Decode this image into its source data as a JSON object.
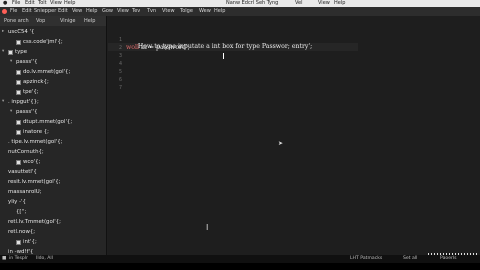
{
  "sysbar": {
    "menu": [
      "File",
      "Edit",
      "Tolt",
      "View",
      "Help"
    ],
    "window_title": "Nanw Edcrl Seh Tyng",
    "right_menu": [
      "Vel",
      "View",
      "Help"
    ]
  },
  "app_menu": {
    "items": [
      "Fle",
      "Edit",
      "Sniepper",
      "Edit",
      "Vew",
      "Help",
      "Gow",
      "View",
      "Tev",
      "Tvn",
      "Vtew",
      "Tolge",
      "Wew",
      "Help"
    ]
  },
  "sidebar": {
    "header": [
      "Pone arch",
      "Vop",
      "Vinige",
      "Help"
    ],
    "rows": [
      {
        "indent": 0,
        "caret": "▸",
        "icon": false,
        "label": "uscC54 '{"
      },
      {
        "indent": 1,
        "caret": "",
        "icon": true,
        "label": "css.code'jml'{;"
      },
      {
        "indent": 0,
        "caret": "▾",
        "icon": true,
        "label": "type"
      },
      {
        "indent": 1,
        "caret": "▾",
        "icon": false,
        "label": "passs''{"
      },
      {
        "indent": 1,
        "caret": "",
        "icon": true,
        "label": "do.lv.mmet(gol'{;"
      },
      {
        "indent": 1,
        "caret": "",
        "icon": true,
        "label": "apzinck{;"
      },
      {
        "indent": 1,
        "caret": "",
        "icon": true,
        "label": "tpe'{;"
      },
      {
        "indent": 0,
        "caret": "▾",
        "icon": false,
        "label": ". inpgut'{};"
      },
      {
        "indent": 1,
        "caret": "▾",
        "icon": false,
        "label": "passs''{"
      },
      {
        "indent": 1,
        "caret": "",
        "icon": true,
        "label": "dtupt.mmet(gol'{;"
      },
      {
        "indent": 1,
        "caret": "",
        "icon": true,
        "label": "inatore {;"
      },
      {
        "indent": 0,
        "caret": "",
        "icon": false,
        "label": ". tipe.lv.mmet(gol'{;"
      },
      {
        "indent": 0,
        "caret": "",
        "icon": false,
        "label": "nutCornuth{;"
      },
      {
        "indent": 1,
        "caret": "",
        "icon": true,
        "label": "wco'{;"
      },
      {
        "indent": 0,
        "caret": "",
        "icon": false,
        "label": "vasuttetl'{"
      },
      {
        "indent": 0,
        "caret": "",
        "icon": false,
        "label": "resit.lv.mmet(gol'{;"
      },
      {
        "indent": 0,
        "caret": "",
        "icon": false,
        "label": "massanrolU;"
      },
      {
        "indent": 0,
        "caret": "",
        "icon": false,
        "label": "yliy -'{"
      },
      {
        "indent": 1,
        "caret": "",
        "icon": false,
        "label": "{['';"
      },
      {
        "indent": 0,
        "caret": "",
        "icon": false,
        "label": "retl.lv.Tmmet(gol'{;"
      },
      {
        "indent": 0,
        "caret": "",
        "icon": false,
        "label": "retl.now{;"
      },
      {
        "indent": 1,
        "caret": "",
        "icon": true,
        "label": "int'{;"
      },
      {
        "indent": 0,
        "caret": "",
        "icon": false,
        "label": "in -wd!f'{"
      }
    ]
  },
  "editor": {
    "line_numbers": [
      "1",
      "2",
      "3",
      "4",
      "5",
      "6",
      "7"
    ],
    "lines": [
      {
        "kw": "",
        "text": "How to type inputate a int box for type Passwor; entry';"
      },
      {
        "kw": "woll",
        "text": " in = password';"
      }
    ]
  },
  "statusbar": {
    "left": "in Tesplr",
    "left2": "Ildo, All",
    "right": [
      "LHT Patmacks",
      "Set all",
      "Paoerls"
    ]
  }
}
